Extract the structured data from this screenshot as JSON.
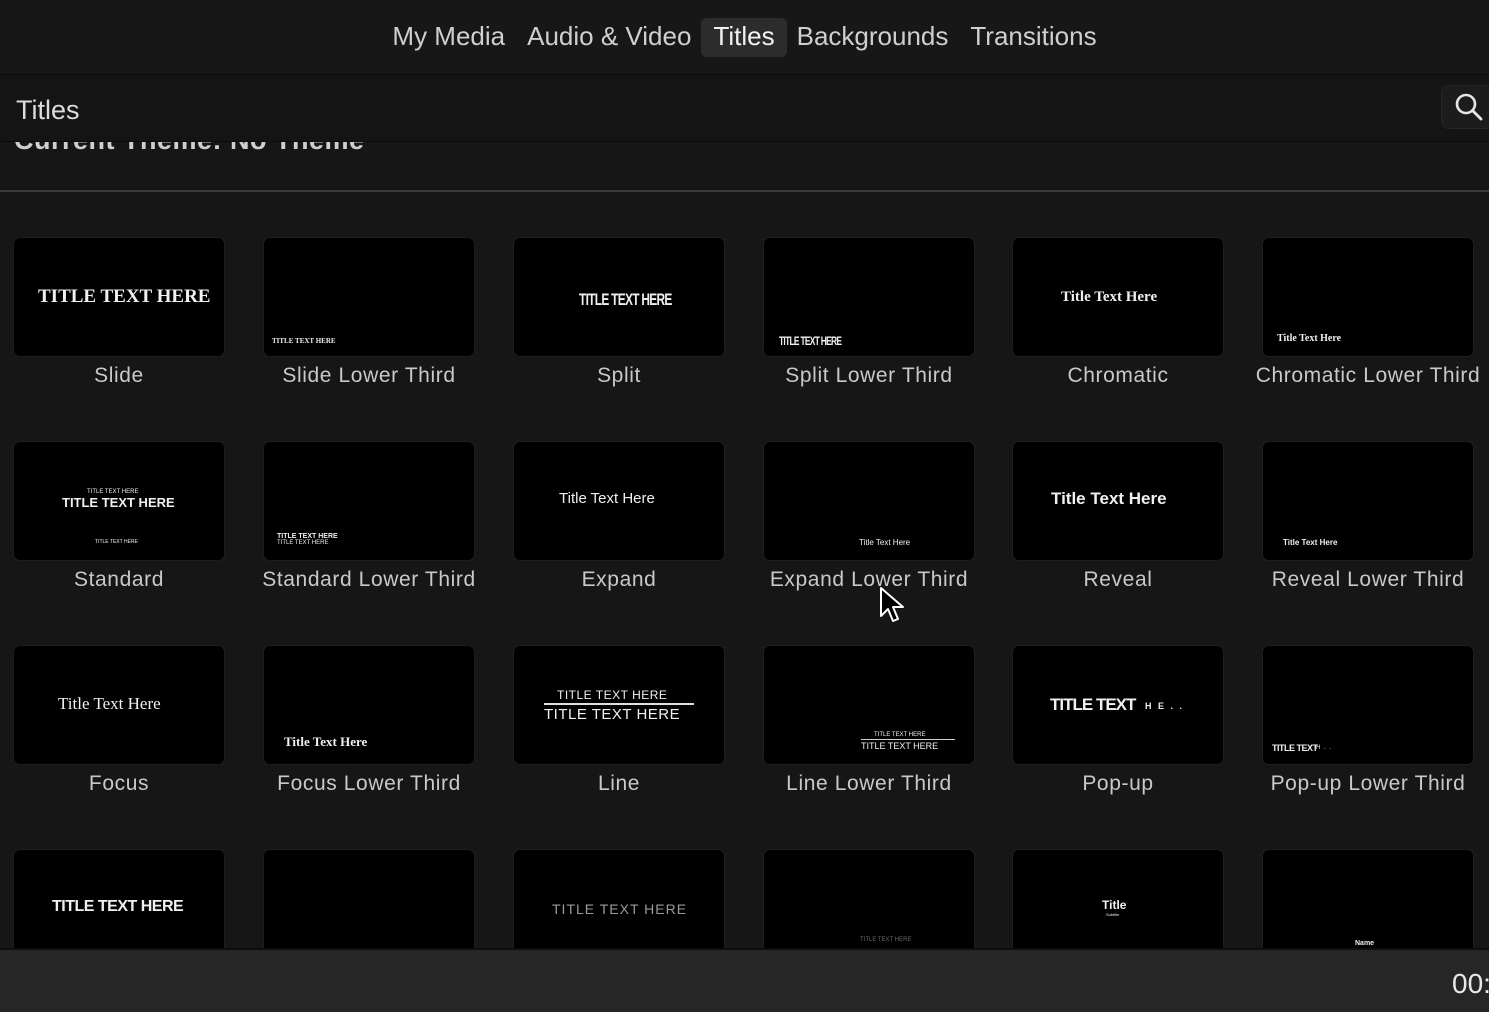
{
  "tabs": [
    {
      "label": "My Media",
      "active": false
    },
    {
      "label": "Audio & Video",
      "active": false
    },
    {
      "label": "Titles",
      "active": true
    },
    {
      "label": "Backgrounds",
      "active": false
    },
    {
      "label": "Transitions",
      "active": false
    }
  ],
  "header": {
    "title": "Titles",
    "search_icon": "search-icon",
    "theme_label": "Current Theme: No Theme"
  },
  "titles": [
    {
      "name": "Slide",
      "preview": [
        "TITLE TEXT HERE"
      ]
    },
    {
      "name": "Slide Lower Third",
      "preview": [
        "TITLE TEXT HERE"
      ]
    },
    {
      "name": "Split",
      "preview": [
        "TITLE TEXT HERE"
      ]
    },
    {
      "name": "Split Lower Third",
      "preview": [
        "TITLE TEXT HERE"
      ]
    },
    {
      "name": "Chromatic",
      "preview": [
        "Title Text Here"
      ]
    },
    {
      "name": "Chromatic Lower Third",
      "preview": [
        "Title Text Here"
      ]
    },
    {
      "name": "Standard",
      "preview": [
        "TITLE TEXT HERE",
        "TITLE TEXT HERE",
        "TITLE TEXT HERE"
      ]
    },
    {
      "name": "Standard Lower Third",
      "preview": [
        "TITLE TEXT HERE",
        "TITLE TEXT HERE"
      ]
    },
    {
      "name": "Expand",
      "preview": [
        "Title Text Here"
      ]
    },
    {
      "name": "Expand Lower Third",
      "preview": [
        "Title Text Here"
      ]
    },
    {
      "name": "Reveal",
      "preview": [
        "Title Text Here"
      ]
    },
    {
      "name": "Reveal Lower Third",
      "preview": [
        "Title Text Here"
      ]
    },
    {
      "name": "Focus",
      "preview": [
        "Title Text Here"
      ]
    },
    {
      "name": "Focus Lower Third",
      "preview": [
        "Title Text Here"
      ]
    },
    {
      "name": "Line",
      "preview": [
        "TITLE TEXT HERE",
        "TITLE TEXT HERE"
      ]
    },
    {
      "name": "Line Lower Third",
      "preview": [
        "TITLE TEXT HERE",
        "TITLE TEXT HERE"
      ]
    },
    {
      "name": "Pop-up",
      "preview": [
        "TITLE TEXT",
        "H E . ."
      ]
    },
    {
      "name": "Pop-up Lower Third",
      "preview": [
        "TITLE TEXT",
        "H . ."
      ]
    },
    {
      "name": "",
      "preview": [
        "TITLE TEXT HERE"
      ]
    },
    {
      "name": "",
      "preview": []
    },
    {
      "name": "",
      "preview": [
        "TITLE TEXT HERE"
      ]
    },
    {
      "name": "",
      "preview": [
        "TITLE TEXT HERE"
      ]
    },
    {
      "name": "",
      "preview": [
        "Title",
        "Subtitle"
      ]
    },
    {
      "name": "",
      "preview": [
        "Name"
      ]
    }
  ],
  "footer": {
    "timecode": "00:"
  },
  "colors": {
    "background": "#161616",
    "active_tab": "#2c2c2c",
    "thumbnail": "#000000",
    "bottom_bar": "#262626"
  }
}
